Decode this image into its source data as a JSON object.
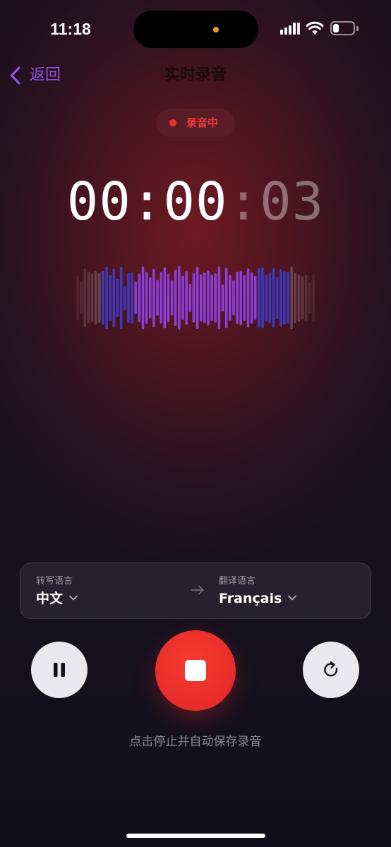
{
  "status_bar": {
    "time": "11:18",
    "battery_level": 0.3
  },
  "nav": {
    "back_label": "返回",
    "title": "实时录音"
  },
  "recording": {
    "badge_label": "录音中",
    "timer_hours": "00",
    "timer_sep1": ":",
    "timer_minutes": "00",
    "timer_sep2": ":",
    "timer_seconds": "03"
  },
  "waveform": {
    "bars": [
      0.66,
      0.48,
      0.87,
      0.76,
      0.71,
      0.79,
      0.73,
      0.8,
      0.92,
      0.68,
      0.87,
      0.56,
      0.92,
      0.36,
      0.74,
      0.76,
      0.48,
      0.72,
      0.93,
      0.77,
      0.61,
      0.86,
      0.53,
      0.76,
      0.9,
      0.71,
      0.52,
      0.83,
      0.94,
      0.65,
      0.79,
      0.42,
      0.73,
      0.92,
      0.7,
      0.75,
      0.81,
      0.68,
      0.73,
      0.93,
      0.4,
      0.89,
      0.68,
      0.52,
      0.77,
      0.8,
      0.68,
      0.87,
      0.76,
      0.65,
      0.88,
      0.9,
      0.69,
      0.75,
      0.88,
      0.63,
      0.85,
      0.79,
      0.77,
      0.93,
      0.75,
      0.7,
      0.64,
      0.68,
      0.45,
      0.68
    ],
    "colors": {
      "faded": "#6f4a55",
      "blue": "#3e3ac0",
      "purple": "#8c3fe0"
    }
  },
  "languages": {
    "source_caption": "转写语言",
    "source_value": "中文",
    "target_caption": "翻译语言",
    "target_value": "Français"
  },
  "controls": {
    "pause_icon": "pause-icon",
    "stop_icon": "stop-icon",
    "redo_icon": "rotate-icon",
    "hint": "点击停止并自动保存录音"
  },
  "colors": {
    "accent_purple": "#8e4fe6",
    "record_red": "#ea2f2b"
  }
}
